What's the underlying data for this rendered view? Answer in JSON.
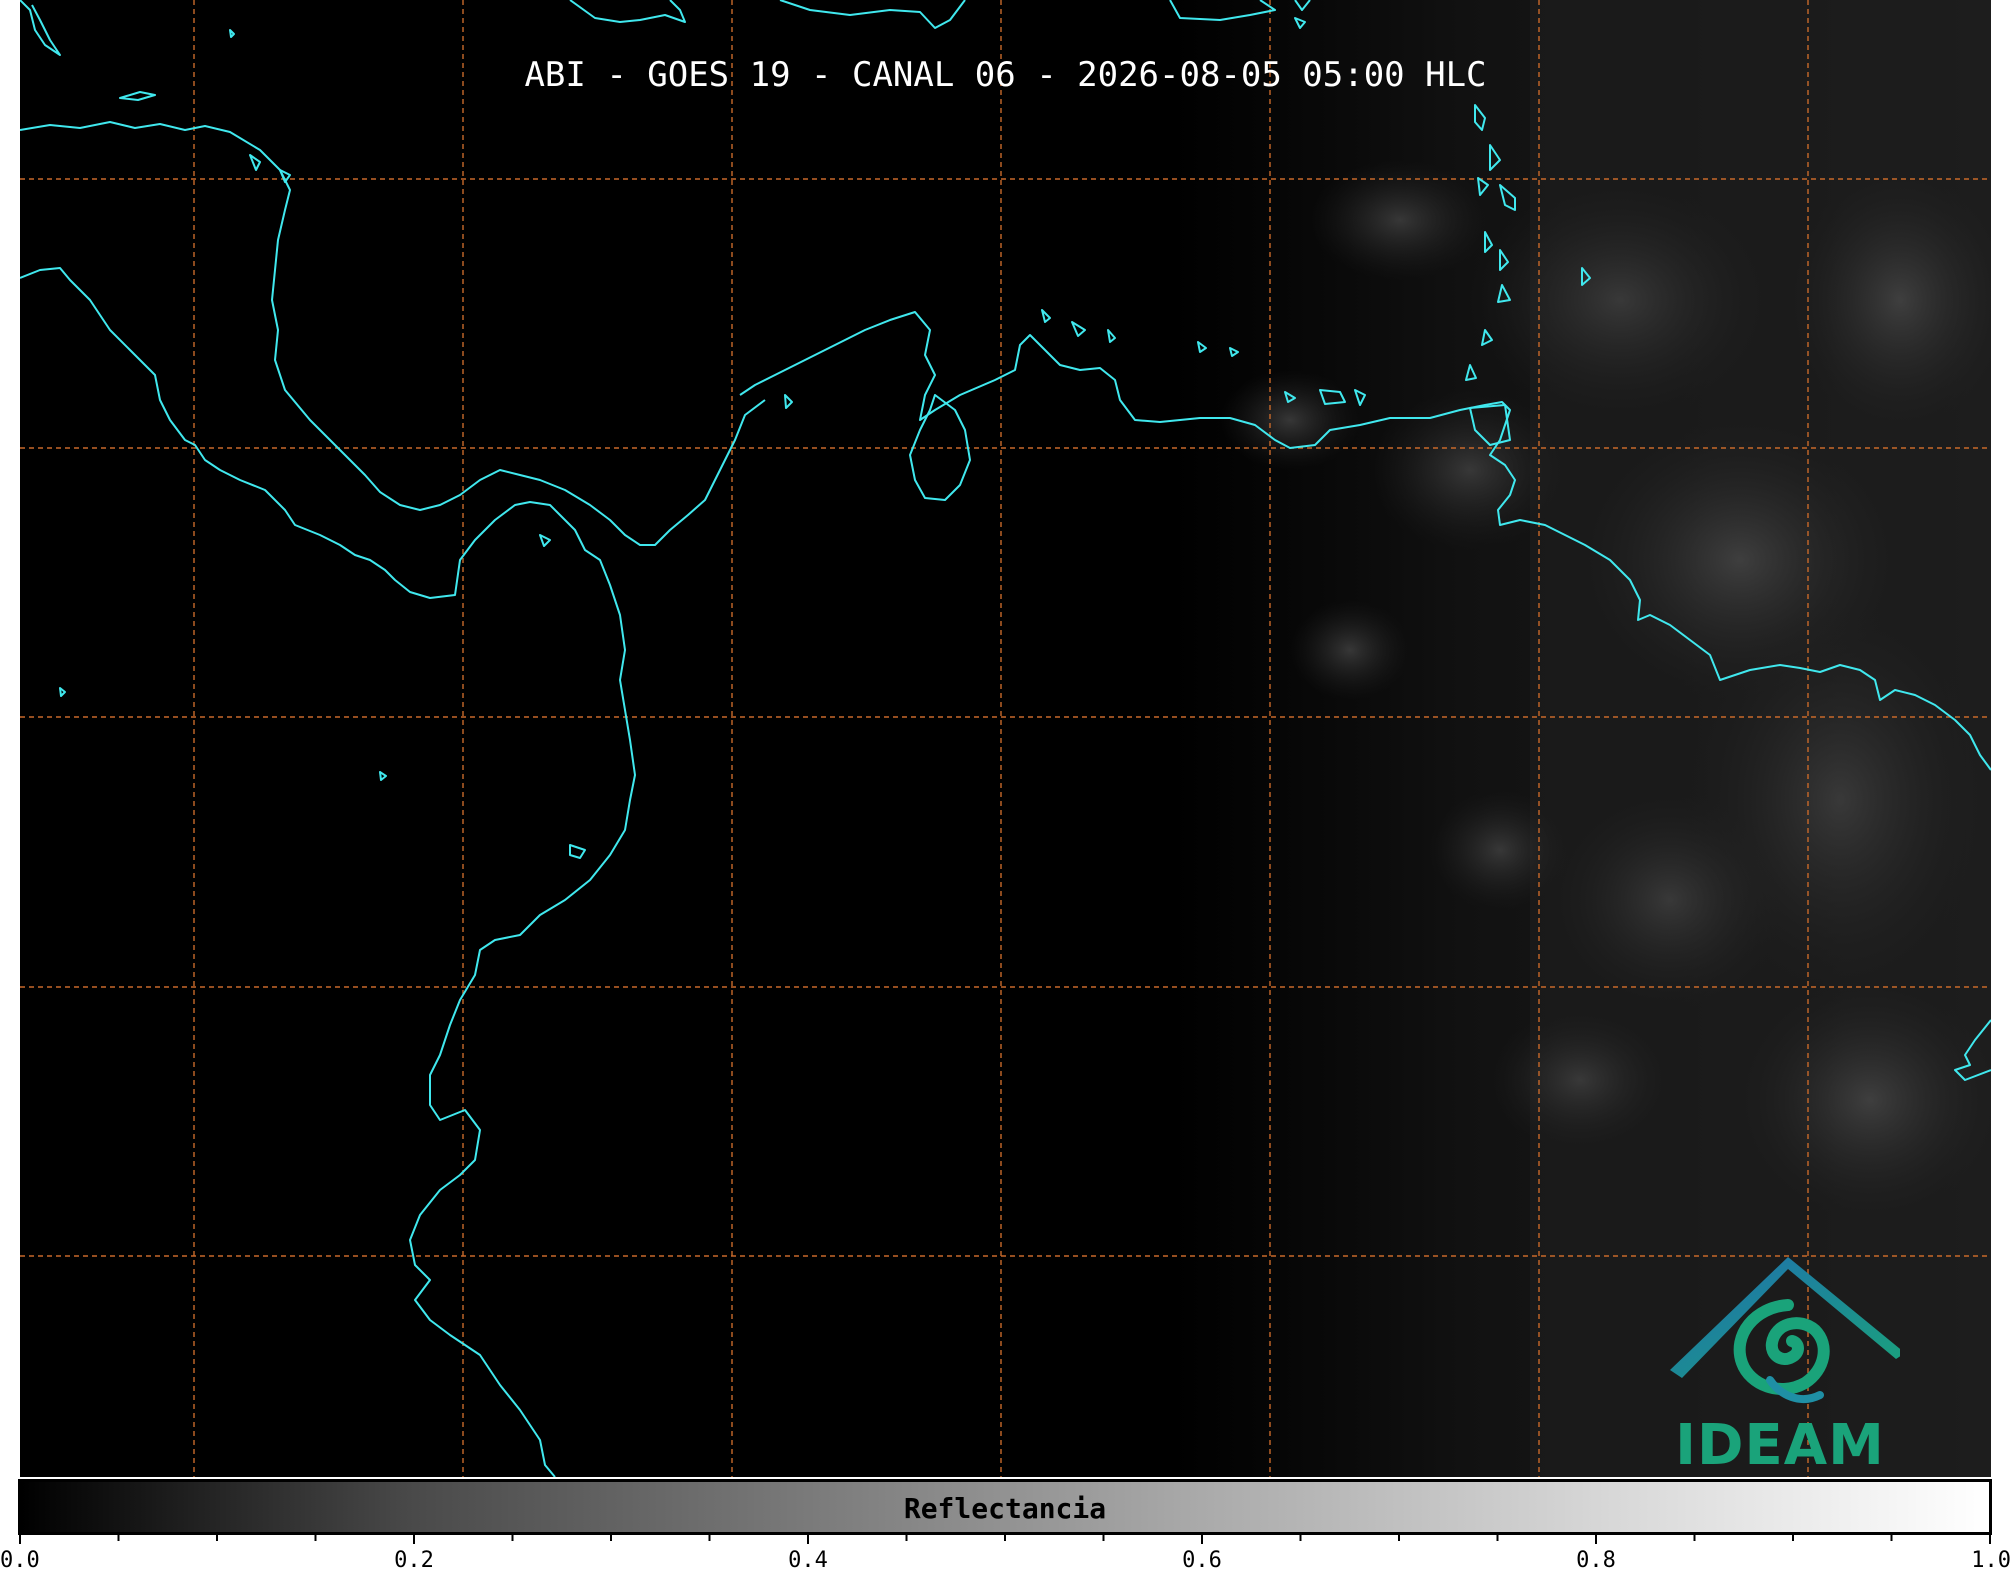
{
  "title": "ABI - GOES 19 - CANAL 06 - 2026-08-05 05:00 HLC",
  "logo": {
    "text": "IDEAM",
    "colors": {
      "teal": "#1aa37a",
      "blue": "#1f6fb0"
    }
  },
  "colorbar": {
    "label": "Reflectancia",
    "range": [
      0.0,
      1.0
    ],
    "tick_labels": [
      "0.0",
      "0.2",
      "0.4",
      "0.6",
      "0.8",
      "1.0"
    ],
    "minor_tick_step": 0.05
  },
  "map": {
    "background": "#000000",
    "coastline_color": "#40e8ee",
    "grid_color": "#c8692a",
    "grid_style": "dashed",
    "cloud_region": "east"
  }
}
